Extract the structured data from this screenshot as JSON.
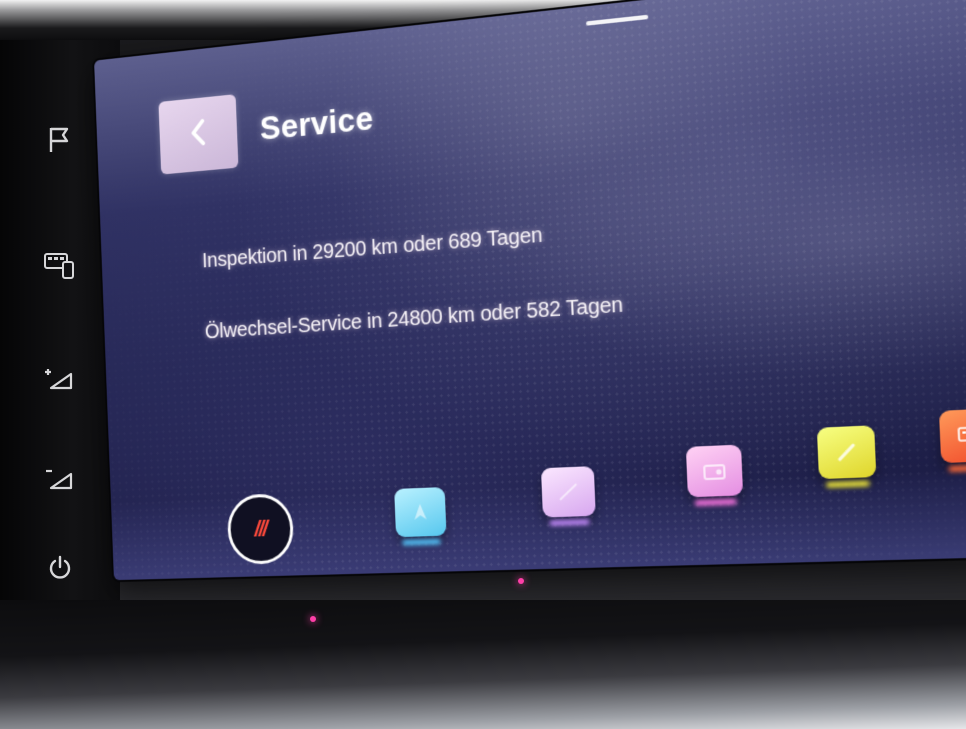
{
  "screen": {
    "title": "Service",
    "back_icon": "chevron-left-icon",
    "lines": [
      "Inspektion in 29200 km oder 689 Tagen",
      "Ölwechsel-Service in 24800 km oder 582 Tagen"
    ]
  },
  "dock": {
    "home_label": "///",
    "apps": [
      {
        "name": "navigation-app",
        "color": "#56c7ee"
      },
      {
        "name": "media-app",
        "color": "#d7a7ef"
      },
      {
        "name": "radio-app",
        "color": "#e48ee2"
      },
      {
        "name": "phone-app",
        "color": "#dfd52b"
      },
      {
        "name": "apps-grid",
        "color": "#f04a2a"
      }
    ]
  },
  "side_buttons": [
    {
      "icon": "flag-icon"
    },
    {
      "icon": "phone-projection-icon"
    },
    {
      "icon": "volume-up-icon",
      "label": "+"
    },
    {
      "icon": "volume-down-icon",
      "label": "-"
    },
    {
      "icon": "power-icon"
    }
  ],
  "colors": {
    "accent_home": "#ff4a3c",
    "screen_bg": "#232551",
    "back_button": "#d9c5e3"
  }
}
